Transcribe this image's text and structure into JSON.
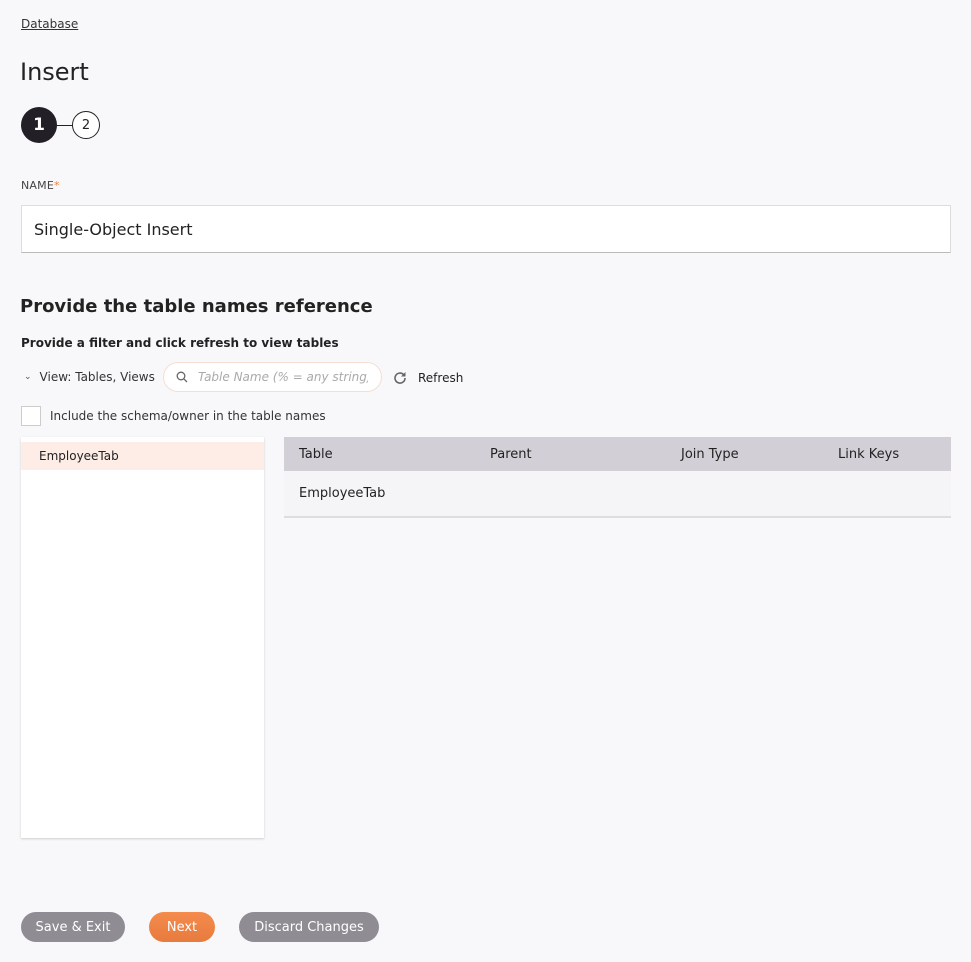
{
  "breadcrumb": "Database",
  "page_title": "Insert",
  "stepper": {
    "steps": [
      "1",
      "2"
    ],
    "current_step": 1
  },
  "name_field": {
    "label": "NAME",
    "required_marker": "*",
    "value": "Single-Object Insert"
  },
  "section": {
    "title": "Provide the table names reference",
    "subtitle": "Provide a filter and click refresh to view tables"
  },
  "filter": {
    "view_label": "View: Tables, Views",
    "search_placeholder": "Table Name (% = any string)",
    "search_value": "",
    "refresh_label": "Refresh"
  },
  "schema_checkbox": {
    "label": "Include the schema/owner in the table names",
    "checked": false
  },
  "available_tables": [
    {
      "name": "EmployeeTab",
      "selected": true
    }
  ],
  "selected_table": {
    "columns": [
      "Table",
      "Parent",
      "Join Type",
      "Link Keys"
    ],
    "rows": [
      {
        "table": "EmployeeTab",
        "parent": "",
        "join_type": "",
        "link_keys": ""
      }
    ]
  },
  "footer": {
    "save_exit": "Save & Exit",
    "next": "Next",
    "discard": "Discard Changes"
  },
  "colors": {
    "accent": "#f0813f",
    "step_active": "#222026",
    "selected_row": "#fdede6",
    "table_header": "#d3cfd6",
    "secondary_button": "#8f8c93"
  }
}
